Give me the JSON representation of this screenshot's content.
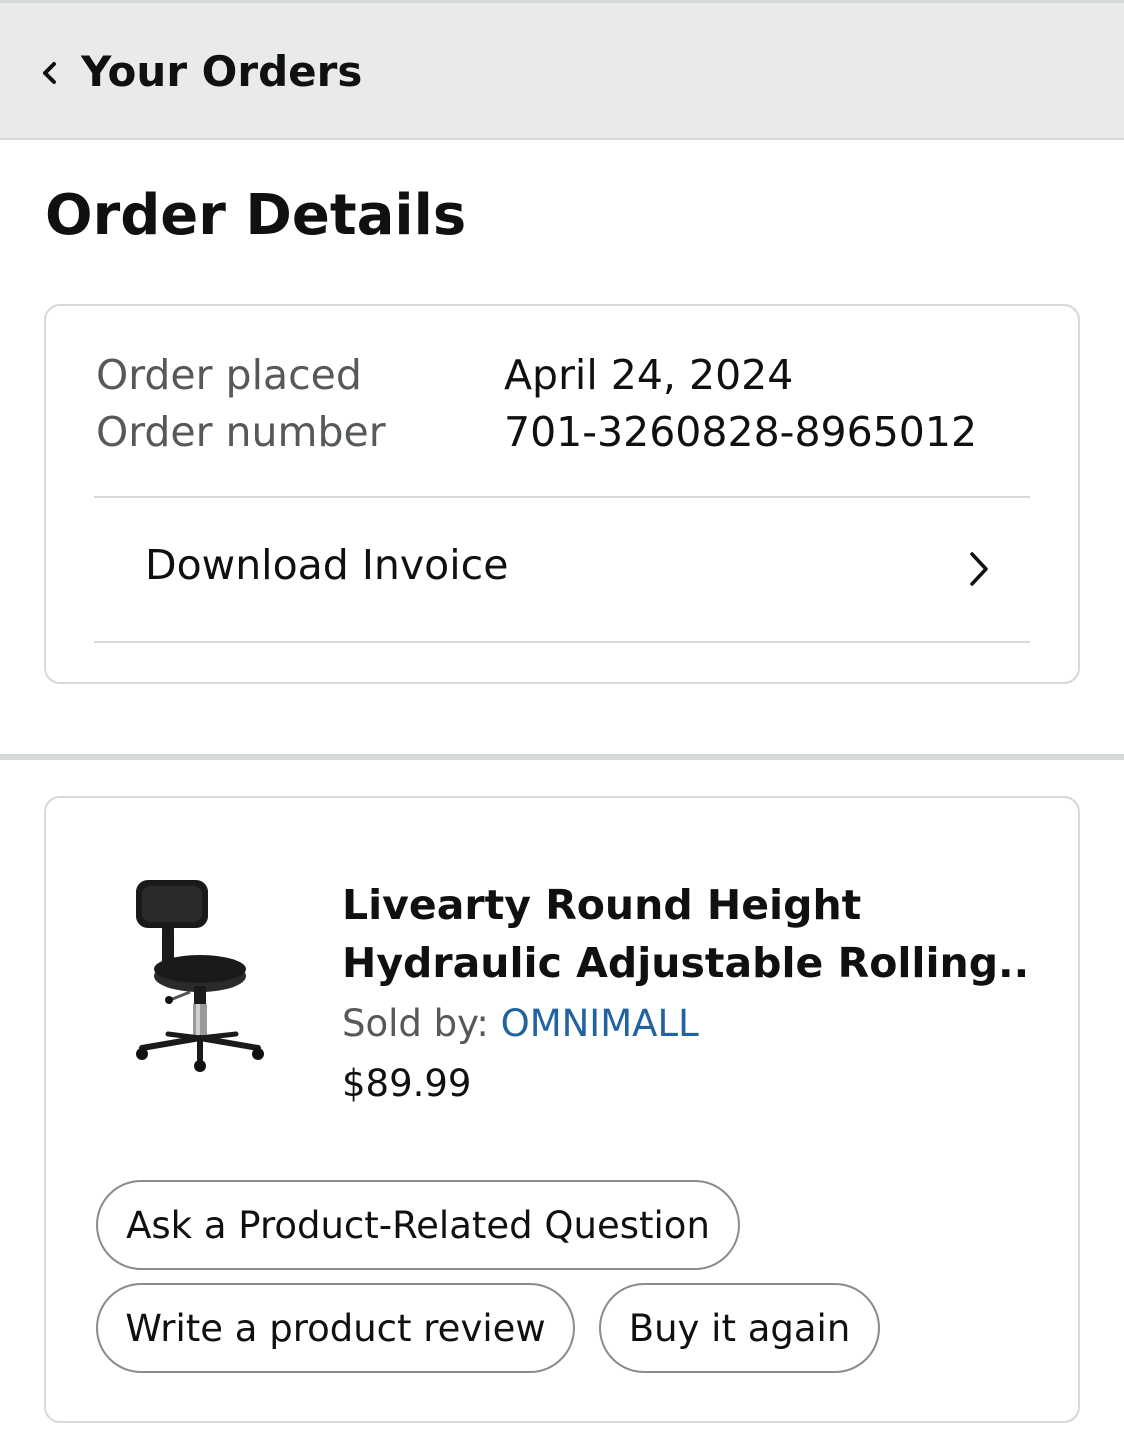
{
  "header": {
    "back_label": "Your Orders",
    "back_icon": "chevron-left-icon"
  },
  "page": {
    "title": "Order Details"
  },
  "order_summary": {
    "placed_label": "Order placed",
    "placed_value": "April 24, 2024",
    "number_label": "Order number",
    "number_value": "701-3260828-8965012",
    "invoice_label": "Download Invoice",
    "invoice_icon": "chevron-right-icon"
  },
  "item": {
    "image_icon": "rolling-stool-image",
    "title_line1": "Livearty Round Height",
    "title_line2": "Hydraulic Adjustable Rolling...",
    "sold_by_label": "Sold by: ",
    "seller": "OMNIMALL",
    "price": "$89.99",
    "actions": {
      "ask_question": "Ask a Product-Related Question",
      "write_review": "Write a product review",
      "buy_again": "Buy it again"
    }
  },
  "colors": {
    "header_bg": "#e9ebeb",
    "border": "#d5d9d9",
    "text_primary": "#0f1111",
    "text_secondary": "#565959",
    "link": "#2162a1"
  }
}
